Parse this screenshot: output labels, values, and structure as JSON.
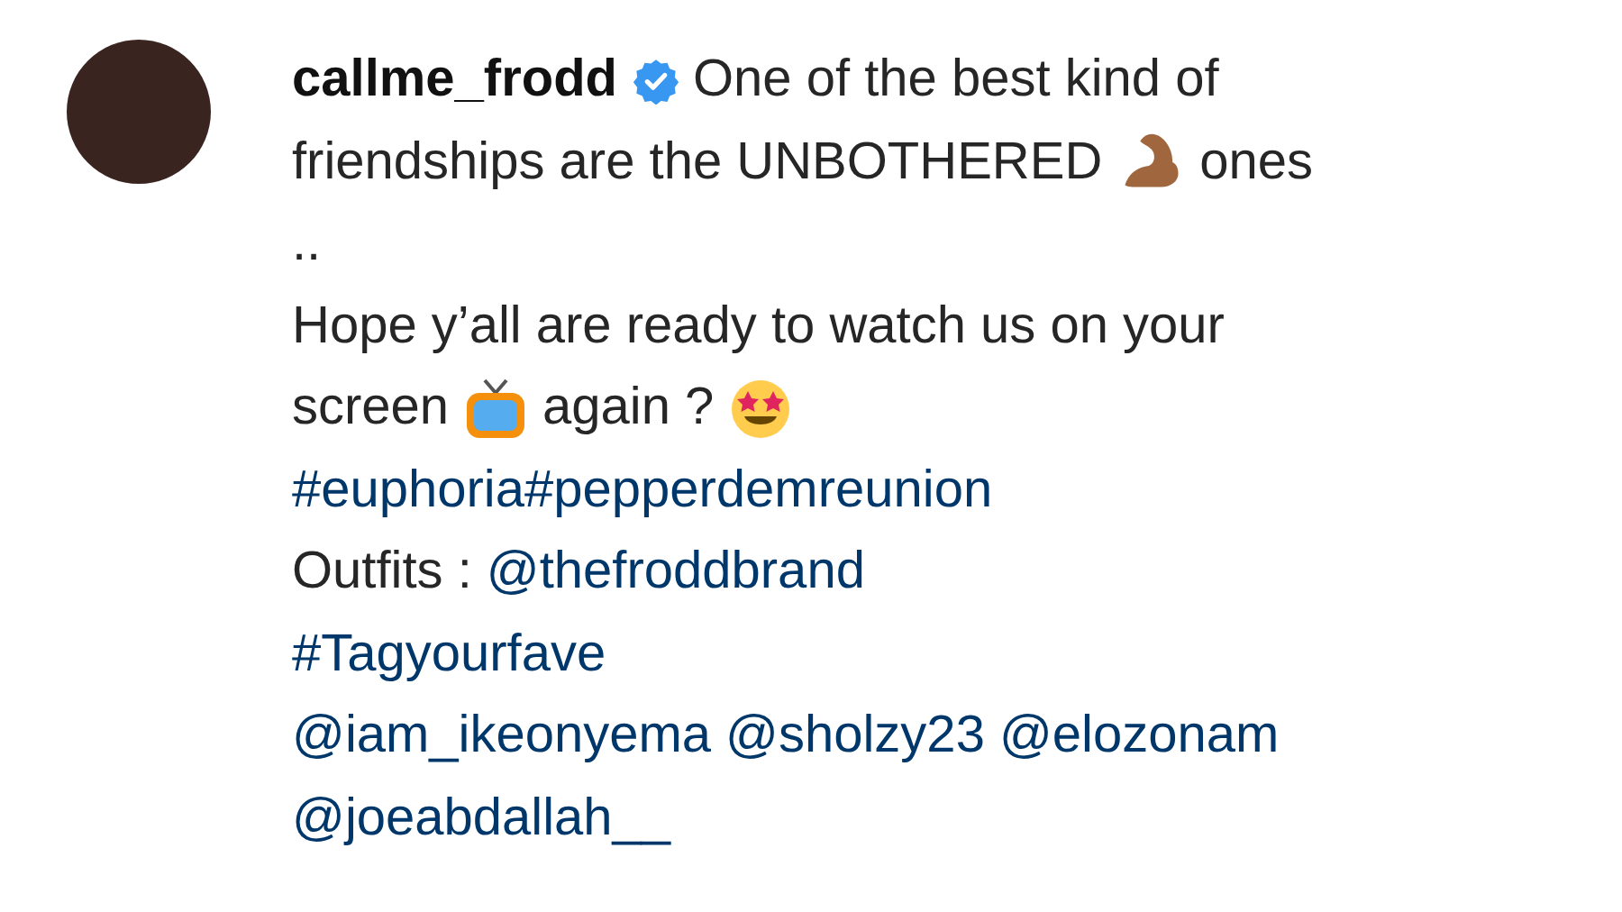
{
  "username": "callme_frodd",
  "verified": true,
  "caption_lines": [
    {
      "segments": [
        {
          "kind": "text",
          "text": "One of the best kind of"
        }
      ]
    },
    {
      "segments": [
        {
          "kind": "text",
          "text": "friendships are the UNBOTHERED"
        },
        {
          "kind": "muscle"
        },
        {
          "kind": "text",
          "text": "ones"
        }
      ]
    },
    {
      "segments": [
        {
          "kind": "text",
          "text": ".."
        }
      ]
    },
    {
      "segments": [
        {
          "kind": "text",
          "text": "Hope y’all are ready to watch us on your"
        }
      ]
    },
    {
      "segments": [
        {
          "kind": "text",
          "text": "screen"
        },
        {
          "kind": "tv"
        },
        {
          "kind": "text",
          "text": "again ?"
        },
        {
          "kind": "starstruck"
        }
      ]
    },
    {
      "segments": [
        {
          "kind": "link",
          "text": "#euphoria#pepperdemreunion"
        }
      ]
    },
    {
      "segments": [
        {
          "kind": "text",
          "text": "Outfits :"
        },
        {
          "kind": "link",
          "text": "@thefroddbrand"
        }
      ]
    },
    {
      "segments": [
        {
          "kind": "link",
          "text": "#Tagyourfave"
        }
      ]
    },
    {
      "segments": [
        {
          "kind": "link",
          "text": "@iam_ikeonyema"
        },
        {
          "kind": "link",
          "text": "@sholzy23"
        },
        {
          "kind": "link",
          "text": "@elozonam"
        }
      ]
    },
    {
      "segments": [
        {
          "kind": "link",
          "text": "@joeabdallah__"
        }
      ]
    }
  ]
}
